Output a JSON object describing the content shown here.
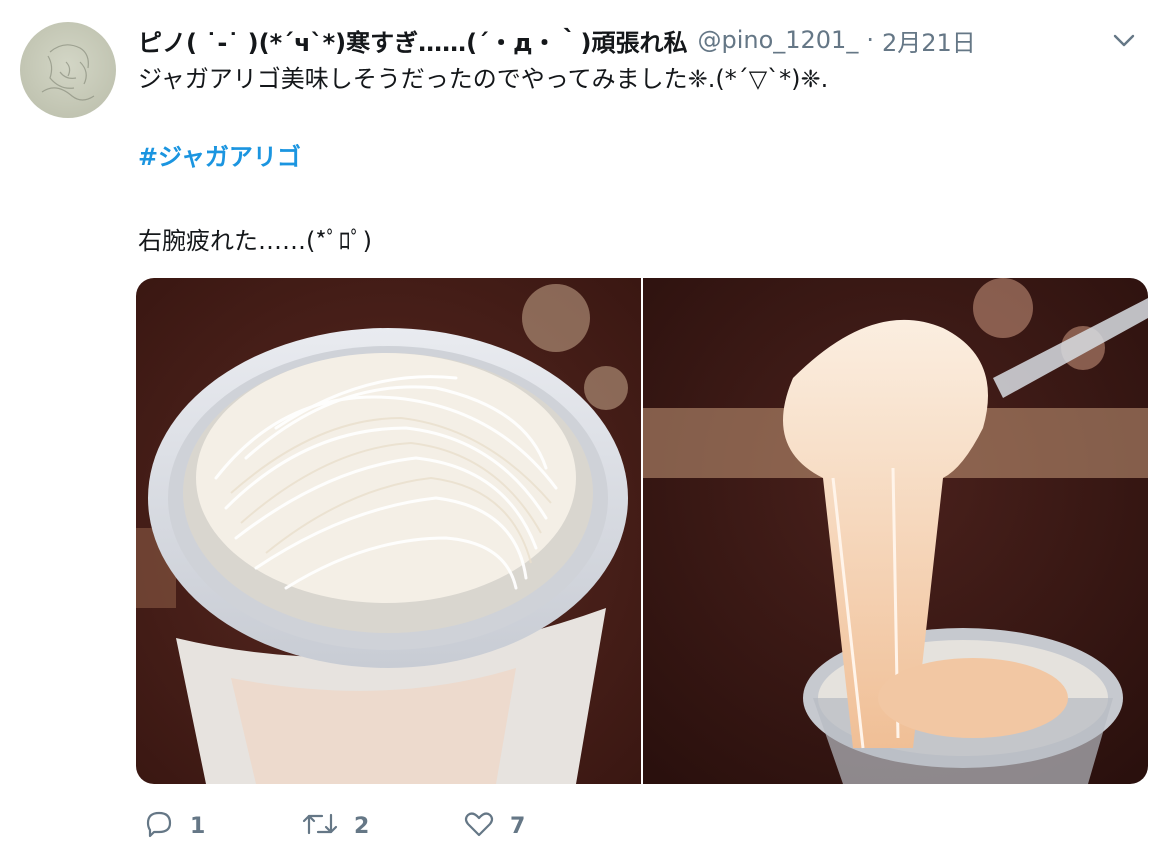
{
  "tweet": {
    "display_name": "ピノ( ˙-˙ )(*´ч`*)寒すぎ……(´・д・｀)頑張れ私",
    "handle": "@pino_1201_",
    "separator": "·",
    "date": "2月21日",
    "text_line1": "ジャガアリゴ美味しそうだったのでやってみました❈.(*´▽`*)❈.",
    "hashtag": "#ジャガアリゴ",
    "text_line3": "右腕疲れた……(*ﾟﾛﾟ)"
  },
  "media": {
    "photo_left_subject": "cup-of-shredded-cheese-on-jagarico",
    "photo_right_subject": "fork-lifting-stretchy-aligot"
  },
  "actions": {
    "reply_count": "1",
    "retweet_count": "2",
    "like_count": "7"
  },
  "colors": {
    "hashtag": "#1b95e0",
    "secondary_text": "#657786",
    "primary_text": "#14171a"
  },
  "icons": [
    "more-caret-icon",
    "reply-icon",
    "retweet-icon",
    "like-icon"
  ]
}
